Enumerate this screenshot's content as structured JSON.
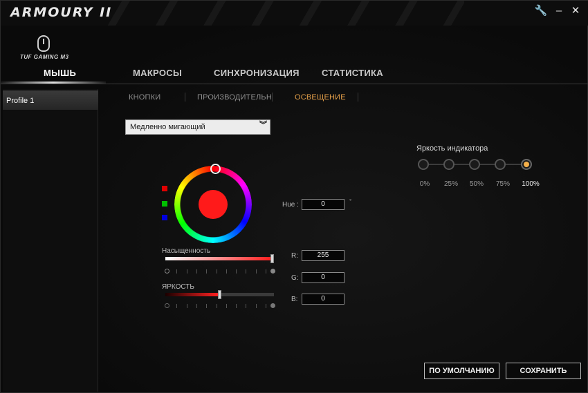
{
  "app": {
    "title": "ARMOURY II",
    "device": "TUF GAMING M3"
  },
  "window_controls": {
    "settings": "🔧",
    "minimize": "–",
    "close": "✕"
  },
  "main_tabs": [
    {
      "label": "МЫШЬ",
      "active": true
    },
    {
      "label": "МАКРОСЫ",
      "active": false
    },
    {
      "label": "СИНХРОНИЗАЦИЯ",
      "active": false
    },
    {
      "label": "СТАТИСТИКА",
      "active": false
    }
  ],
  "sidebar": {
    "profiles": [
      {
        "label": "Profile 1",
        "selected": true
      }
    ]
  },
  "sub_tabs": [
    {
      "label": "КНОПКИ",
      "active": false
    },
    {
      "label": "ПРОИЗВОДИТЕЛЬН",
      "active": false
    },
    {
      "label": "ОСВЕЩЕНИЕ",
      "active": true
    }
  ],
  "effect": {
    "selected": "Медленно мигающий"
  },
  "indicator": {
    "label": "Яркость индикатора",
    "levels": [
      "0%",
      "25%",
      "50%",
      "75%",
      "100%"
    ],
    "selected": "100%"
  },
  "color": {
    "swatches": [
      "#e00000",
      "#00c000",
      "#0000e0"
    ],
    "current": "#ff1a1a",
    "hue_label": "Hue :",
    "hue_value": "0",
    "hue_unit": "°",
    "r_label": "R:",
    "r_value": "255",
    "g_label": "G:",
    "g_value": "0",
    "b_label": "B:",
    "b_value": "0"
  },
  "saturation": {
    "label": "Насыщенность",
    "value": 1.0
  },
  "brightness": {
    "label": "ЯРКОСТЬ",
    "value": 0.5
  },
  "actions": {
    "default_label": "ПО УМОЛЧАНИЮ",
    "save_label": "СОХРАНИТЬ"
  },
  "accent_color": "#e8a24a"
}
